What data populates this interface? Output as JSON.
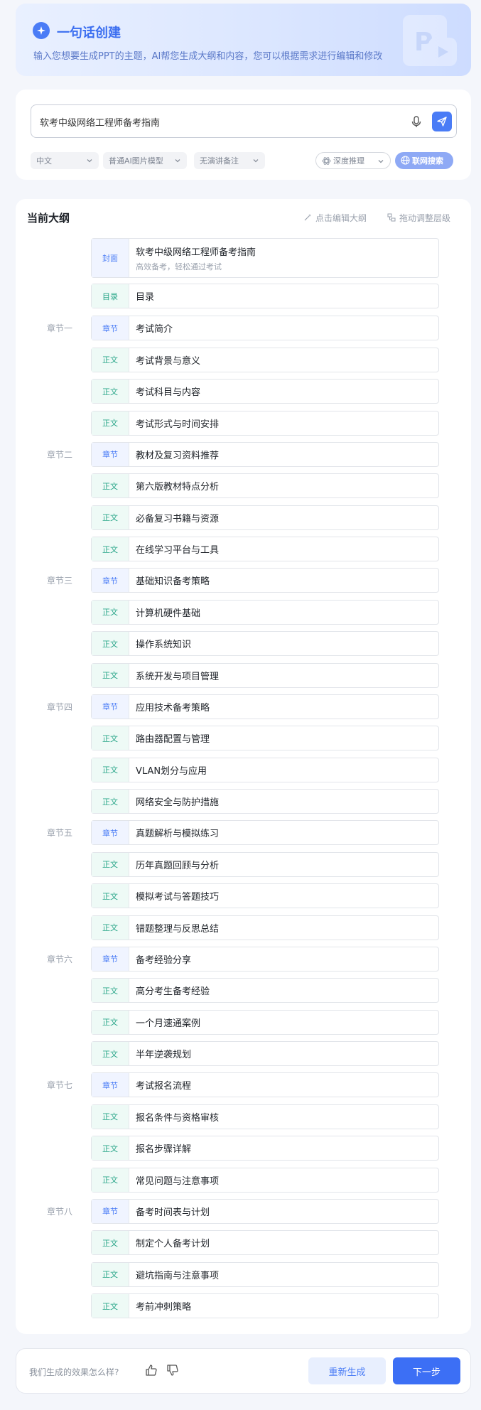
{
  "header": {
    "title": "一句话创建",
    "description": "输入您想要生成PPT的主题，AI帮您生成大纲和内容，您可以根据需求进行编辑和修改"
  },
  "input": {
    "value": "软考中级网络工程师备考指南",
    "options": {
      "language": "中文",
      "image_model": "普通AI图片模型",
      "notes": "无演讲备注"
    },
    "deep_reasoning_label": "深度推理",
    "web_search_label": "联网搜索"
  },
  "outline": {
    "title": "当前大纲",
    "edit_label": "点击编辑大纲",
    "drag_label": "拖动调整层级",
    "tags": {
      "cover": "封面",
      "toc": "目录",
      "chapter": "章节",
      "body": "正文"
    },
    "cover": {
      "title": "软考中级网络工程师备考指南",
      "subtitle": "高效备考，轻松通过考试"
    },
    "toc": "目录",
    "chapters": [
      {
        "label": "章节一",
        "title": "考试简介",
        "items": [
          "考试背景与意义",
          "考试科目与内容",
          "考试形式与时间安排"
        ]
      },
      {
        "label": "章节二",
        "title": "教材及复习资料推荐",
        "items": [
          "第六版教材特点分析",
          "必备复习书籍与资源",
          "在线学习平台与工具"
        ]
      },
      {
        "label": "章节三",
        "title": "基础知识备考策略",
        "items": [
          "计算机硬件基础",
          "操作系统知识",
          "系统开发与项目管理"
        ]
      },
      {
        "label": "章节四",
        "title": "应用技术备考策略",
        "items": [
          "路由器配置与管理",
          "VLAN划分与应用",
          "网络安全与防护措施"
        ]
      },
      {
        "label": "章节五",
        "title": "真题解析与模拟练习",
        "items": [
          "历年真题回顾与分析",
          "模拟考试与答题技巧",
          "错题整理与反思总结"
        ]
      },
      {
        "label": "章节六",
        "title": "备考经验分享",
        "items": [
          "高分考生备考经验",
          "一个月速通案例",
          "半年逆袭规划"
        ]
      },
      {
        "label": "章节七",
        "title": "考试报名流程",
        "items": [
          "报名条件与资格审核",
          "报名步骤详解",
          "常见问题与注意事项"
        ]
      },
      {
        "label": "章节八",
        "title": "备考时间表与计划",
        "items": [
          "制定个人备考计划",
          "避坑指南与注意事项",
          "考前冲刺策略"
        ]
      }
    ]
  },
  "footer": {
    "question": "我们生成的效果怎么样?",
    "regenerate_label": "重新生成",
    "next_label": "下一步"
  }
}
